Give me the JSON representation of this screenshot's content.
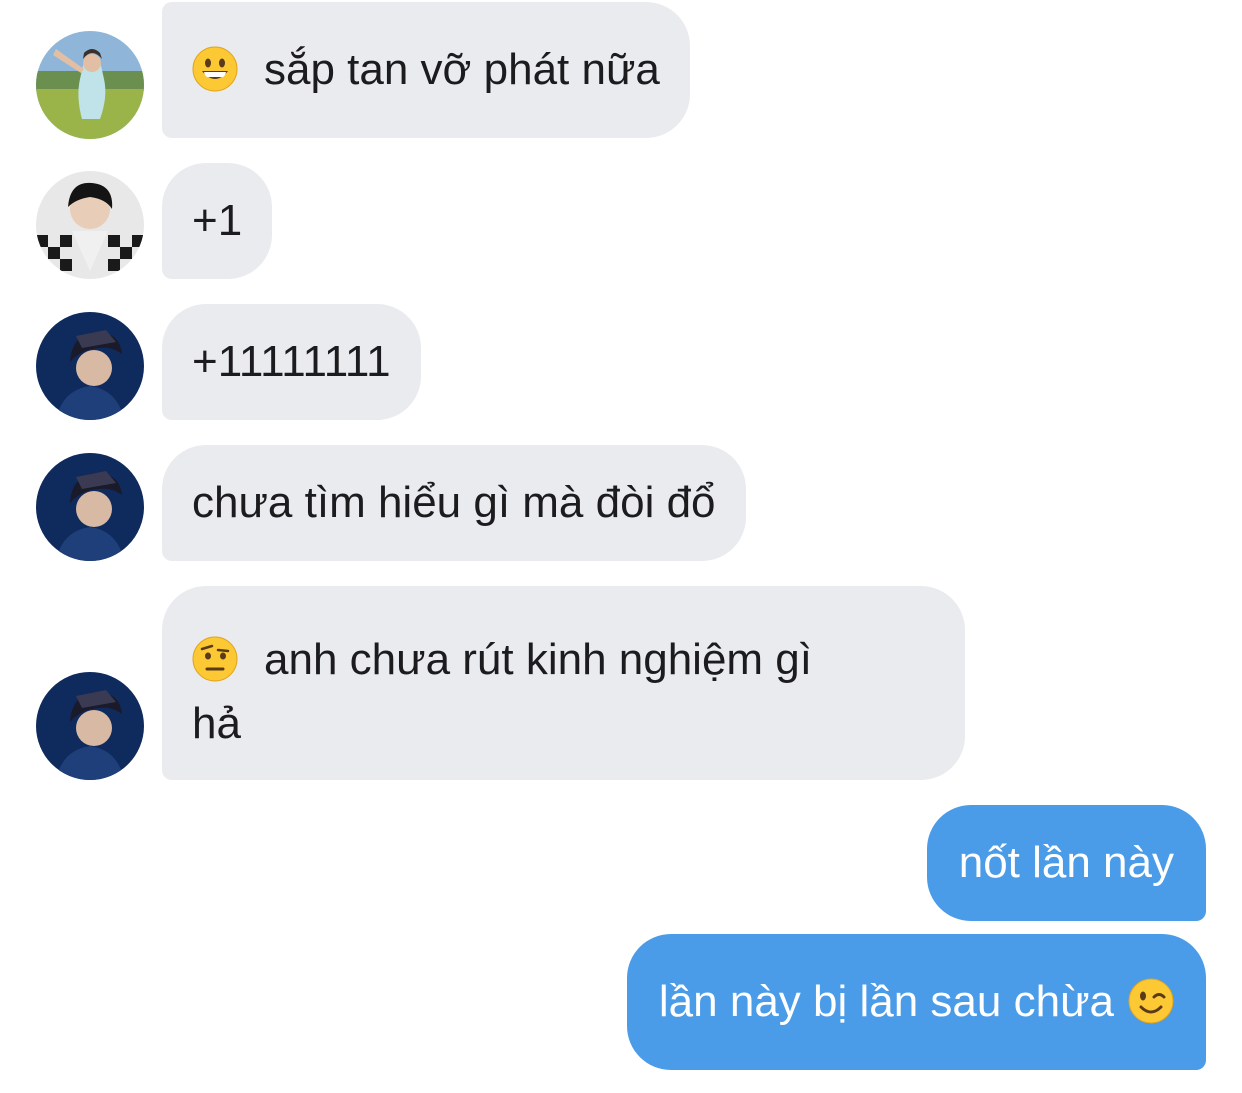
{
  "colors": {
    "incoming_bubble": "#e9ebef",
    "outgoing_bubble": "#4a9be8",
    "text_dark": "#1c1c1e",
    "text_light": "#ffffff"
  },
  "messages": [
    {
      "direction": "incoming",
      "sender_avatar": "avatar-outdoor-photo",
      "emoji": "grinning-face-icon",
      "text": "sắp tan vỡ phát nữa"
    },
    {
      "direction": "incoming",
      "sender_avatar": "avatar-checkered-photo",
      "text": "+1"
    },
    {
      "direction": "incoming",
      "sender_avatar": "avatar-dark-blue-photo",
      "text": "+11111111"
    },
    {
      "direction": "incoming",
      "sender_avatar": "avatar-dark-blue-photo",
      "text": "chưa tìm hiểu gì mà đòi đổ"
    },
    {
      "direction": "incoming",
      "sender_avatar": "avatar-dark-blue-photo",
      "emoji": "raised-eyebrow-face-icon",
      "text_line1": "anh chưa rút kinh nghiệm gì",
      "text_line2": "hả"
    },
    {
      "direction": "outgoing",
      "text": "nốt lần này"
    },
    {
      "direction": "outgoing",
      "emoji": "winking-face-icon",
      "text": "lần này bị lần sau chừa"
    }
  ]
}
